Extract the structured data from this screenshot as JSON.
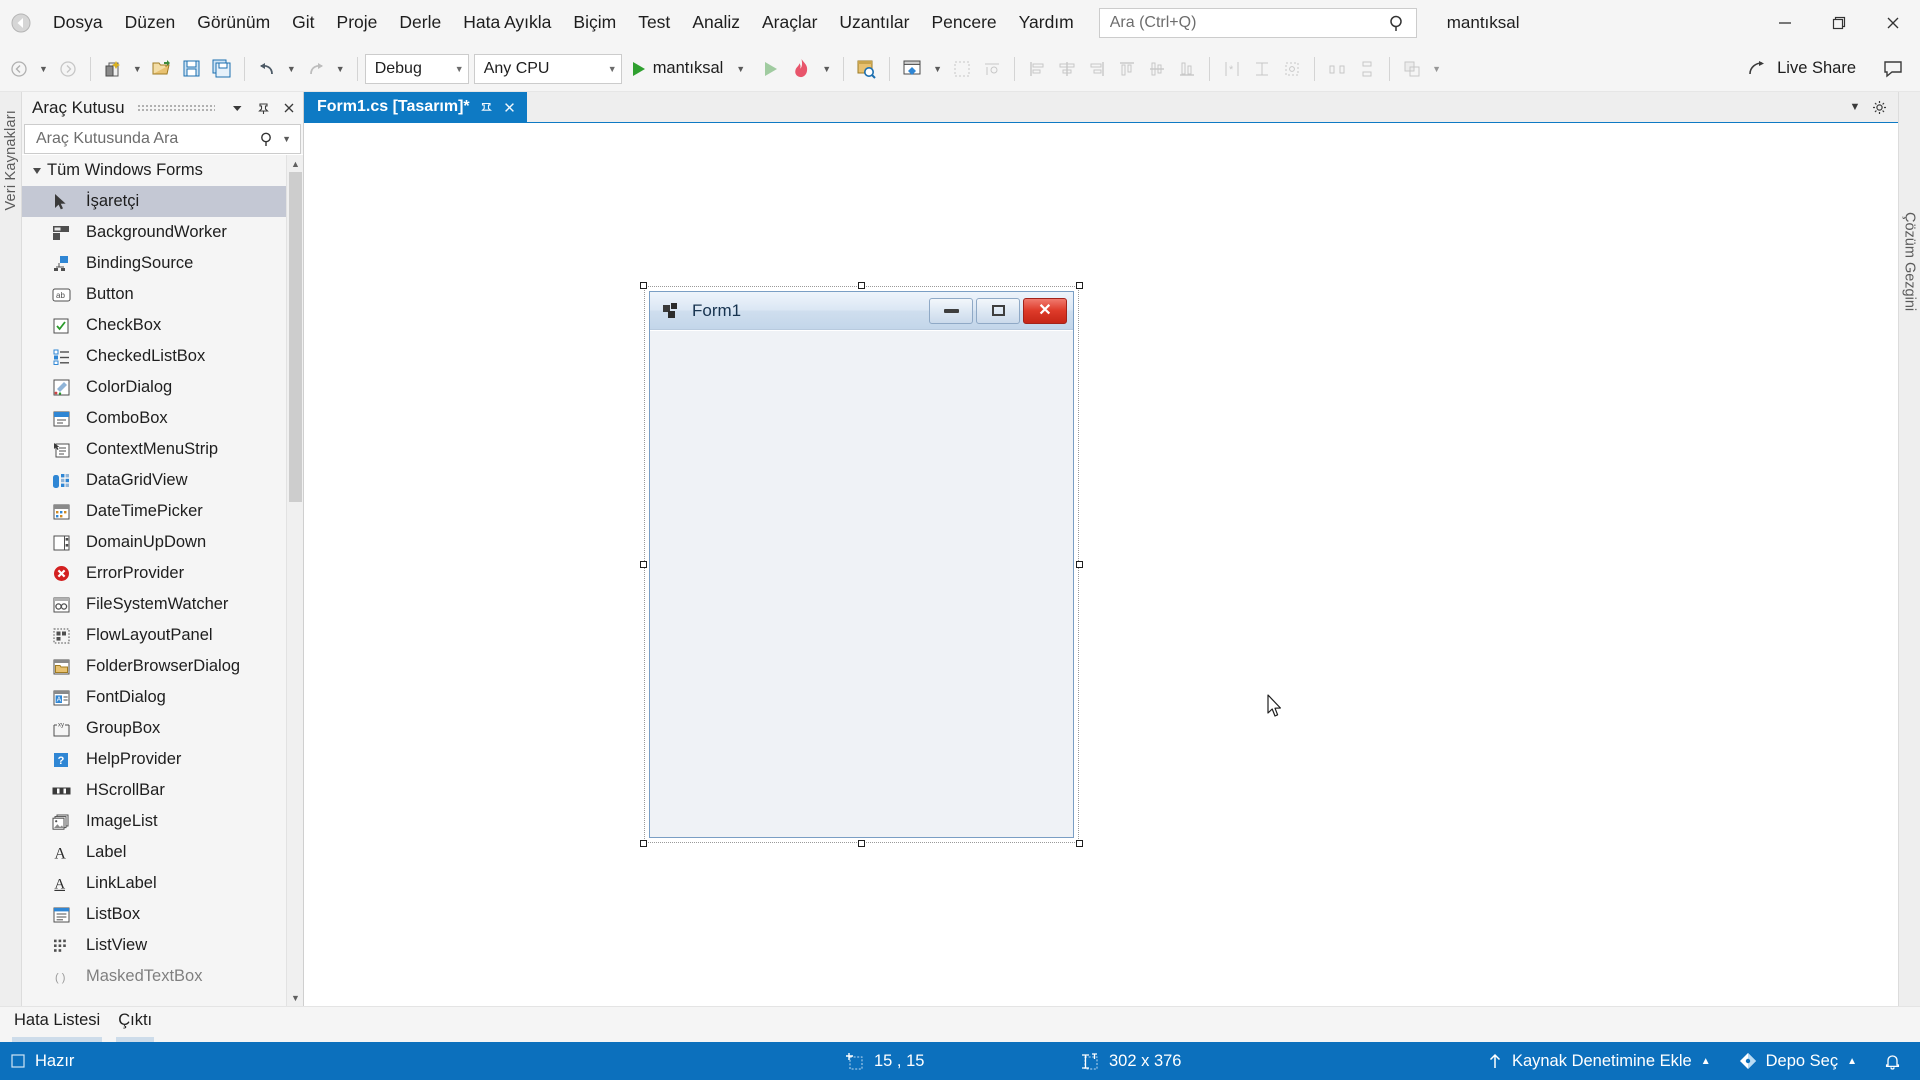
{
  "window": {
    "project_name": "mantıksal",
    "minimize_label": "—",
    "maximize_label": "❐",
    "close_label": "✕"
  },
  "menubar": {
    "items": [
      {
        "label": "Dosya"
      },
      {
        "label": "Düzen"
      },
      {
        "label": "Görünüm"
      },
      {
        "label": "Git"
      },
      {
        "label": "Proje"
      },
      {
        "label": "Derle"
      },
      {
        "label": "Hata Ayıkla"
      },
      {
        "label": "Biçim"
      },
      {
        "label": "Test"
      },
      {
        "label": "Analiz"
      },
      {
        "label": "Araçlar"
      },
      {
        "label": "Uzantılar"
      },
      {
        "label": "Pencere"
      },
      {
        "label": "Yardım"
      }
    ],
    "search": {
      "placeholder": "Ara (Ctrl+Q)",
      "value": ""
    }
  },
  "toolbar": {
    "configuration": "Debug",
    "platform": "Any CPU",
    "start_label": "mantıksal",
    "live_share_label": "Live Share"
  },
  "left_strip": {
    "vertical_tab": "Veri Kaynakları"
  },
  "toolbox": {
    "title": "Araç Kutusu",
    "search_placeholder": "Araç Kutusunda Ara",
    "search_value": "",
    "group_label": "Tüm Windows Forms",
    "items": [
      {
        "label": "İşaretçi",
        "icon": "pointer-icon",
        "selected": true
      },
      {
        "label": "BackgroundWorker",
        "icon": "backgroundworker-icon",
        "selected": false
      },
      {
        "label": "BindingSource",
        "icon": "bindingsource-icon",
        "selected": false
      },
      {
        "label": "Button",
        "icon": "button-icon",
        "selected": false
      },
      {
        "label": "CheckBox",
        "icon": "checkbox-icon",
        "selected": false
      },
      {
        "label": "CheckedListBox",
        "icon": "checkedlistbox-icon",
        "selected": false
      },
      {
        "label": "ColorDialog",
        "icon": "colordialog-icon",
        "selected": false
      },
      {
        "label": "ComboBox",
        "icon": "combobox-icon",
        "selected": false
      },
      {
        "label": "ContextMenuStrip",
        "icon": "contextmenustrip-icon",
        "selected": false
      },
      {
        "label": "DataGridView",
        "icon": "datagridview-icon",
        "selected": false
      },
      {
        "label": "DateTimePicker",
        "icon": "datetimepicker-icon",
        "selected": false
      },
      {
        "label": "DomainUpDown",
        "icon": "domainupdown-icon",
        "selected": false
      },
      {
        "label": "ErrorProvider",
        "icon": "errorprovider-icon",
        "selected": false
      },
      {
        "label": "FileSystemWatcher",
        "icon": "filesystemwatcher-icon",
        "selected": false
      },
      {
        "label": "FlowLayoutPanel",
        "icon": "flowlayoutpanel-icon",
        "selected": false
      },
      {
        "label": "FolderBrowserDialog",
        "icon": "folderbrowserdialog-icon",
        "selected": false
      },
      {
        "label": "FontDialog",
        "icon": "fontdialog-icon",
        "selected": false
      },
      {
        "label": "GroupBox",
        "icon": "groupbox-icon",
        "selected": false
      },
      {
        "label": "HelpProvider",
        "icon": "helpprovider-icon",
        "selected": false
      },
      {
        "label": "HScrollBar",
        "icon": "hscrollbar-icon",
        "selected": false
      },
      {
        "label": "ImageList",
        "icon": "imagelist-icon",
        "selected": false
      },
      {
        "label": "Label",
        "icon": "label-icon",
        "selected": false
      },
      {
        "label": "LinkLabel",
        "icon": "linklabel-icon",
        "selected": false
      },
      {
        "label": "ListBox",
        "icon": "listbox-icon",
        "selected": false
      },
      {
        "label": "ListView",
        "icon": "listview-icon",
        "selected": false
      },
      {
        "label": "MaskedTextBox",
        "icon": "maskedtextbox-icon",
        "selected": false
      }
    ]
  },
  "document": {
    "tab_label": "Form1.cs [Tasarım]*"
  },
  "designer": {
    "form_title": "Form1",
    "min_label": "",
    "max_label": "",
    "close_label": "✕"
  },
  "right_strip": {
    "vertical_tab": "Çözüm Gezgini"
  },
  "bottom_tabs": [
    {
      "label": "Hata Listesi"
    },
    {
      "label": "Çıktı"
    }
  ],
  "statusbar": {
    "ready": "Hazır",
    "position": "15 , 15",
    "size": "302 x 376",
    "source_control": "Kaynak Denetimine Ekle",
    "repo": "Depo Seç"
  },
  "colors": {
    "accent_blue": "#0c70bd",
    "tab_blue": "#0e7ac4",
    "chrome_gray": "#f5f5f5",
    "selection_gray": "#c4c8d4",
    "close_red": "#c62617"
  }
}
